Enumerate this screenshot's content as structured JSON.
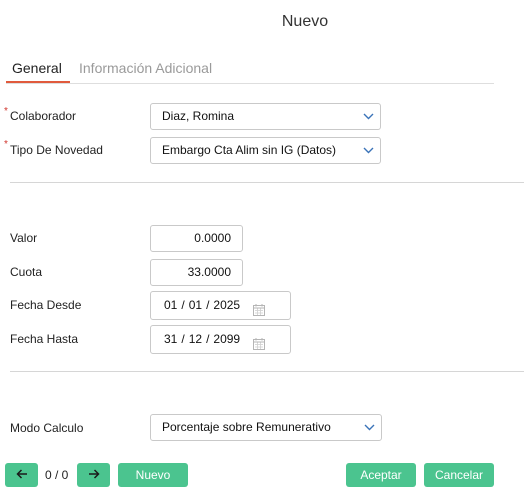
{
  "dialog": {
    "title": "Nuevo"
  },
  "tabs": [
    {
      "label": "General",
      "active": true
    },
    {
      "label": "Información Adicional",
      "active": false
    }
  ],
  "fields": {
    "colaborador": {
      "label": "Colaborador",
      "required_mark": "*",
      "value": "Diaz, Romina"
    },
    "tipo_novedad": {
      "label": "Tipo De Novedad",
      "required_mark": "*",
      "value": "Embargo Cta Alim sin IG (Datos)"
    },
    "valor": {
      "label": "Valor",
      "value": "0.0000"
    },
    "cuota": {
      "label": "Cuota",
      "value": "33.0000"
    },
    "fecha_desde": {
      "label": "Fecha Desde",
      "day": "01",
      "month": "01",
      "year": "2025",
      "separator": "/"
    },
    "fecha_hasta": {
      "label": "Fecha Hasta",
      "day": "31",
      "month": "12",
      "year": "2099",
      "separator": "/"
    },
    "modo_calculo": {
      "label": "Modo Calculo",
      "value": "Porcentaje sobre Remunerativo"
    }
  },
  "footer": {
    "counter": "0 / 0",
    "new_label": "Nuevo",
    "accept_label": "Aceptar",
    "cancel_label": "Cancelar"
  },
  "colors": {
    "accent": "#4bc48f",
    "tab_underline": "#e15a3c",
    "required": "#d0342c",
    "chevron": "#3a73b8"
  },
  "icons": {
    "prev": "arrow-left-icon",
    "next": "arrow-right-icon",
    "dropdown": "chevron-down-icon",
    "calendar": "calendar-icon"
  }
}
